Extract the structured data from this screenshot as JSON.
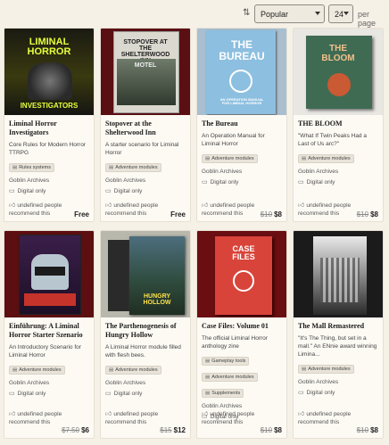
{
  "toolbar": {
    "sort_icon": "sort-icon",
    "sort_value": "Popular",
    "per_page_value": "24",
    "per_page_label": "per page"
  },
  "products": [
    {
      "cover_text": "LIMINAL HORROR",
      "cover_sub": "INVESTIGATORS",
      "title": "Liminal Horror Investigators",
      "desc": "Core Rules for Modern Horror TTRPG",
      "tags": [
        "Rules systems"
      ],
      "publisher": "Goblin Archives",
      "format": "Digital only",
      "recommend": "undefined people recommend this",
      "price_old": "",
      "price": "Free"
    },
    {
      "cover_text": "STOPOVER AT THE SHELTERWOOD INN",
      "cover_sub": "MOTEL",
      "title": "Stopover at the Shelterwood Inn",
      "desc": "A starter scenario for Liminal Horror",
      "tags": [
        "Adventure modules"
      ],
      "publisher": "Goblin Archives",
      "format": "Digital only",
      "recommend": "undefined people recommend this",
      "price_old": "",
      "price": "Free"
    },
    {
      "cover_text": "THE BUREAU",
      "cover_sub": "AN OPERATION MANUAL FOR LIMINAL HORROR",
      "title": "The Bureau",
      "desc": "An Operation Manual for Liminal Horror",
      "tags": [
        "Adventure modules"
      ],
      "publisher": "Goblin Archives",
      "format": "Digital only",
      "recommend": "undefined people recommend this",
      "price_old": "$10",
      "price": "$8"
    },
    {
      "cover_text": "THE BLOOM",
      "cover_sub": "",
      "title": "THE BLOOM",
      "desc": "\"What If Twin Peaks Had a Last of Us arc?\"",
      "tags": [
        "Adventure modules"
      ],
      "publisher": "Goblin Archives",
      "format": "Digital only",
      "recommend": "undefined people recommend this",
      "price_old": "$10",
      "price": "$8"
    },
    {
      "cover_text": "",
      "cover_sub": "",
      "title": "Einführung: A Liminal Horror Starter Szenario",
      "desc": "An Introductory Scenario for Liminal Horror",
      "tags": [
        "Adventure modules"
      ],
      "publisher": "Goblin Archives",
      "format": "Digital only",
      "recommend": "undefined people recommend this",
      "price_old": "$7.50",
      "price": "$6"
    },
    {
      "cover_text": "HUNGRY HOLLOW",
      "cover_sub": "",
      "title": "The Parthenogenesis of Hungry Hollow",
      "desc": "A Liminal Horror module filled with flesh bees.",
      "tags": [
        "Adventure modules"
      ],
      "publisher": "Goblin Archives",
      "format": "Digital only",
      "recommend": "undefined people recommend this",
      "price_old": "$15",
      "price": "$12"
    },
    {
      "cover_text": "CASE FILES",
      "cover_sub": "",
      "title": "Case Files: Volume 01",
      "desc": "The official Liminal Horror anthology zine",
      "tags": [
        "Gameplay tools",
        "Adventure modules",
        "Supplements"
      ],
      "publisher": "Goblin Archives",
      "format": "Digital only",
      "recommend": "undefined people recommend this",
      "price_old": "$10",
      "price": "$8"
    },
    {
      "cover_text": "",
      "cover_sub": "",
      "title": "The Mall Remastered",
      "desc": "\"It's The Thing, but set in a mall.\" An ENnie award winning Limina...",
      "tags": [
        "Adventure modules"
      ],
      "publisher": "Goblin Archives",
      "format": "Digital only",
      "recommend": "undefined people recommend this",
      "price_old": "$10",
      "price": "$8"
    }
  ]
}
